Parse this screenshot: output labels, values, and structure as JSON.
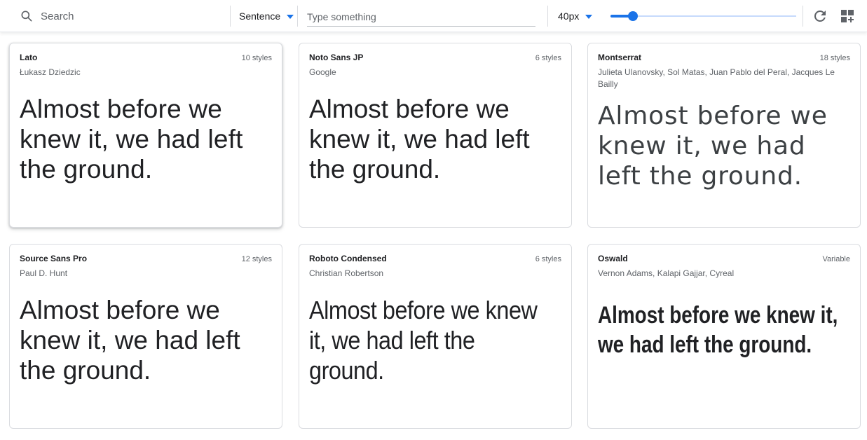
{
  "toolbar": {
    "search_placeholder": "Search",
    "preview_mode": "Sentence",
    "type_placeholder": "Type something",
    "font_size": "40px",
    "size_slider_fraction": 0.12,
    "accent_color": "#1a73e8"
  },
  "icons": {
    "search": "search-icon",
    "preview_mode_dropdown": "chevron-down-icon",
    "font_size_dropdown": "chevron-down-icon",
    "refresh": "refresh-icon",
    "grid": "grid-add-icon"
  },
  "cards": [
    {
      "name": "Lato",
      "styles": "10 styles",
      "designer": "Łukasz Dziedzic",
      "specimen": "Almost before we knew it, we had left the ground."
    },
    {
      "name": "Noto Sans JP",
      "styles": "6 styles",
      "designer": "Google",
      "specimen": "Almost before we knew it, we had left the ground."
    },
    {
      "name": "Montserrat",
      "styles": "18 styles",
      "designer": "Julieta Ulanovsky, Sol Matas, Juan Pablo del Peral, Jacques Le Bailly",
      "specimen": "Almost before we knew it, we had left the ground."
    },
    {
      "name": "Source Sans Pro",
      "styles": "12 styles",
      "designer": "Paul D. Hunt",
      "specimen": "Almost before we knew it, we had left the ground."
    },
    {
      "name": "Roboto Condensed",
      "styles": "6 styles",
      "designer": "Christian Robertson",
      "specimen": "Almost before we knew it, we had left the ground."
    },
    {
      "name": "Oswald",
      "styles": "Variable",
      "designer": "Vernon Adams, Kalapi Gajjar, Cyreal",
      "specimen": "Almost before we knew it, we had left the ground."
    }
  ]
}
